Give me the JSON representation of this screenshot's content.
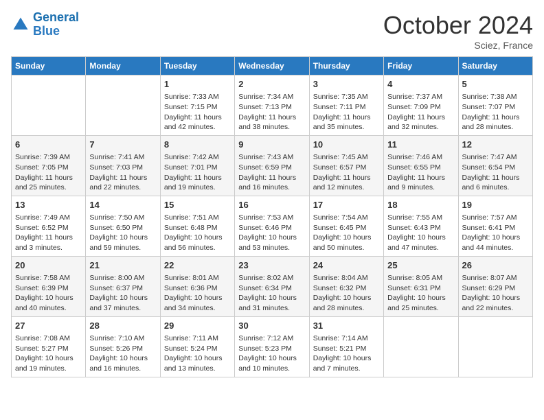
{
  "header": {
    "logo_line1": "General",
    "logo_line2": "Blue",
    "month": "October 2024",
    "location": "Sciez, France"
  },
  "days_of_week": [
    "Sunday",
    "Monday",
    "Tuesday",
    "Wednesday",
    "Thursday",
    "Friday",
    "Saturday"
  ],
  "weeks": [
    [
      {
        "day": "",
        "info": ""
      },
      {
        "day": "",
        "info": ""
      },
      {
        "day": "1",
        "info": "Sunrise: 7:33 AM\nSunset: 7:15 PM\nDaylight: 11 hours and 42 minutes."
      },
      {
        "day": "2",
        "info": "Sunrise: 7:34 AM\nSunset: 7:13 PM\nDaylight: 11 hours and 38 minutes."
      },
      {
        "day": "3",
        "info": "Sunrise: 7:35 AM\nSunset: 7:11 PM\nDaylight: 11 hours and 35 minutes."
      },
      {
        "day": "4",
        "info": "Sunrise: 7:37 AM\nSunset: 7:09 PM\nDaylight: 11 hours and 32 minutes."
      },
      {
        "day": "5",
        "info": "Sunrise: 7:38 AM\nSunset: 7:07 PM\nDaylight: 11 hours and 28 minutes."
      }
    ],
    [
      {
        "day": "6",
        "info": "Sunrise: 7:39 AM\nSunset: 7:05 PM\nDaylight: 11 hours and 25 minutes."
      },
      {
        "day": "7",
        "info": "Sunrise: 7:41 AM\nSunset: 7:03 PM\nDaylight: 11 hours and 22 minutes."
      },
      {
        "day": "8",
        "info": "Sunrise: 7:42 AM\nSunset: 7:01 PM\nDaylight: 11 hours and 19 minutes."
      },
      {
        "day": "9",
        "info": "Sunrise: 7:43 AM\nSunset: 6:59 PM\nDaylight: 11 hours and 16 minutes."
      },
      {
        "day": "10",
        "info": "Sunrise: 7:45 AM\nSunset: 6:57 PM\nDaylight: 11 hours and 12 minutes."
      },
      {
        "day": "11",
        "info": "Sunrise: 7:46 AM\nSunset: 6:55 PM\nDaylight: 11 hours and 9 minutes."
      },
      {
        "day": "12",
        "info": "Sunrise: 7:47 AM\nSunset: 6:54 PM\nDaylight: 11 hours and 6 minutes."
      }
    ],
    [
      {
        "day": "13",
        "info": "Sunrise: 7:49 AM\nSunset: 6:52 PM\nDaylight: 11 hours and 3 minutes."
      },
      {
        "day": "14",
        "info": "Sunrise: 7:50 AM\nSunset: 6:50 PM\nDaylight: 10 hours and 59 minutes."
      },
      {
        "day": "15",
        "info": "Sunrise: 7:51 AM\nSunset: 6:48 PM\nDaylight: 10 hours and 56 minutes."
      },
      {
        "day": "16",
        "info": "Sunrise: 7:53 AM\nSunset: 6:46 PM\nDaylight: 10 hours and 53 minutes."
      },
      {
        "day": "17",
        "info": "Sunrise: 7:54 AM\nSunset: 6:45 PM\nDaylight: 10 hours and 50 minutes."
      },
      {
        "day": "18",
        "info": "Sunrise: 7:55 AM\nSunset: 6:43 PM\nDaylight: 10 hours and 47 minutes."
      },
      {
        "day": "19",
        "info": "Sunrise: 7:57 AM\nSunset: 6:41 PM\nDaylight: 10 hours and 44 minutes."
      }
    ],
    [
      {
        "day": "20",
        "info": "Sunrise: 7:58 AM\nSunset: 6:39 PM\nDaylight: 10 hours and 40 minutes."
      },
      {
        "day": "21",
        "info": "Sunrise: 8:00 AM\nSunset: 6:37 PM\nDaylight: 10 hours and 37 minutes."
      },
      {
        "day": "22",
        "info": "Sunrise: 8:01 AM\nSunset: 6:36 PM\nDaylight: 10 hours and 34 minutes."
      },
      {
        "day": "23",
        "info": "Sunrise: 8:02 AM\nSunset: 6:34 PM\nDaylight: 10 hours and 31 minutes."
      },
      {
        "day": "24",
        "info": "Sunrise: 8:04 AM\nSunset: 6:32 PM\nDaylight: 10 hours and 28 minutes."
      },
      {
        "day": "25",
        "info": "Sunrise: 8:05 AM\nSunset: 6:31 PM\nDaylight: 10 hours and 25 minutes."
      },
      {
        "day": "26",
        "info": "Sunrise: 8:07 AM\nSunset: 6:29 PM\nDaylight: 10 hours and 22 minutes."
      }
    ],
    [
      {
        "day": "27",
        "info": "Sunrise: 7:08 AM\nSunset: 5:27 PM\nDaylight: 10 hours and 19 minutes."
      },
      {
        "day": "28",
        "info": "Sunrise: 7:10 AM\nSunset: 5:26 PM\nDaylight: 10 hours and 16 minutes."
      },
      {
        "day": "29",
        "info": "Sunrise: 7:11 AM\nSunset: 5:24 PM\nDaylight: 10 hours and 13 minutes."
      },
      {
        "day": "30",
        "info": "Sunrise: 7:12 AM\nSunset: 5:23 PM\nDaylight: 10 hours and 10 minutes."
      },
      {
        "day": "31",
        "info": "Sunrise: 7:14 AM\nSunset: 5:21 PM\nDaylight: 10 hours and 7 minutes."
      },
      {
        "day": "",
        "info": ""
      },
      {
        "day": "",
        "info": ""
      }
    ]
  ]
}
